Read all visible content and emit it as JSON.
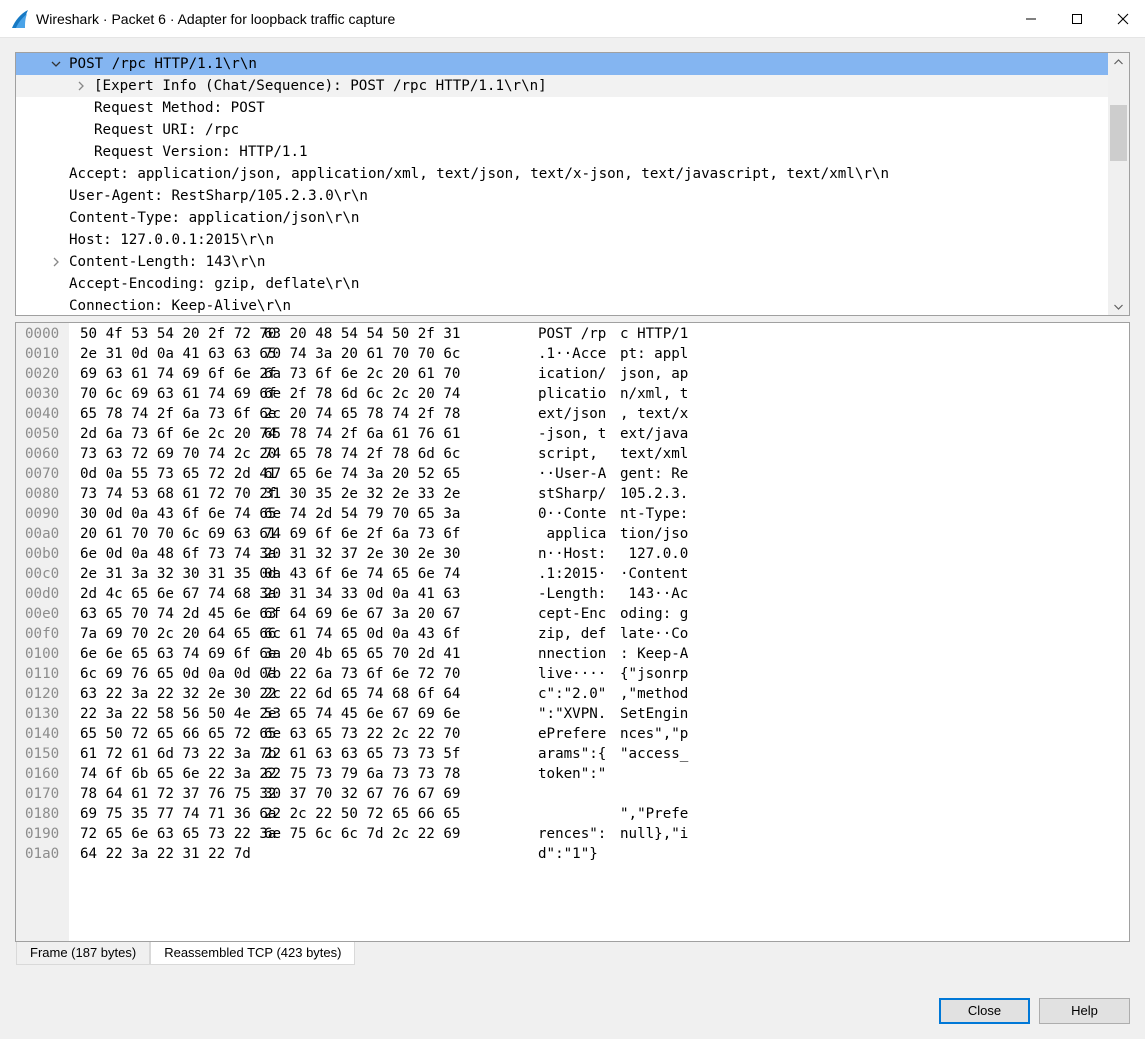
{
  "window": {
    "title": "Wireshark · Packet 6 · Adapter for loopback traffic capture"
  },
  "tree": {
    "lines": [
      {
        "text": "POST /rpc HTTP/1.1\\r\\n",
        "expander": "expanded",
        "level": 0,
        "state": "selected"
      },
      {
        "text": "[Expert Info (Chat/Sequence): POST /rpc HTTP/1.1\\r\\n]",
        "expander": "collapsed",
        "level": 1,
        "state": "hover"
      },
      {
        "text": "Request Method: POST",
        "expander": "none",
        "level": 1,
        "state": ""
      },
      {
        "text": "Request URI: /rpc",
        "expander": "none",
        "level": 1,
        "state": ""
      },
      {
        "text": "Request Version: HTTP/1.1",
        "expander": "none",
        "level": 1,
        "state": ""
      },
      {
        "text": "Accept: application/json, application/xml, text/json, text/x-json, text/javascript, text/xml\\r\\n",
        "expander": "none",
        "level": 0,
        "state": ""
      },
      {
        "text": "User-Agent: RestSharp/105.2.3.0\\r\\n",
        "expander": "none",
        "level": 0,
        "state": ""
      },
      {
        "text": "Content-Type: application/json\\r\\n",
        "expander": "none",
        "level": 0,
        "state": ""
      },
      {
        "text": "Host: 127.0.0.1:2015\\r\\n",
        "expander": "none",
        "level": 0,
        "state": ""
      },
      {
        "text": "Content-Length: 143\\r\\n",
        "expander": "collapsed",
        "level": 0,
        "state": ""
      },
      {
        "text": "Accept-Encoding: gzip, deflate\\r\\n",
        "expander": "none",
        "level": 0,
        "state": ""
      },
      {
        "text": "Connection: Keep-Alive\\r\\n",
        "expander": "none",
        "level": 0,
        "state": ""
      }
    ]
  },
  "hex": {
    "rows": [
      {
        "offset": "0000",
        "hex1": "50 4f 53 54 20 2f 72 70",
        "hex2": "63 20 48 54 54 50 2f 31",
        "ascii1": "POST /rp",
        "ascii2": "c HTTP/1"
      },
      {
        "offset": "0010",
        "hex1": "2e 31 0d 0a 41 63 63 65",
        "hex2": "70 74 3a 20 61 70 70 6c",
        "ascii1": ".1··Acce",
        "ascii2": "pt: appl"
      },
      {
        "offset": "0020",
        "hex1": "69 63 61 74 69 6f 6e 2f",
        "hex2": "6a 73 6f 6e 2c 20 61 70",
        "ascii1": "ication/",
        "ascii2": "json, ap"
      },
      {
        "offset": "0030",
        "hex1": "70 6c 69 63 61 74 69 6f",
        "hex2": "6e 2f 78 6d 6c 2c 20 74",
        "ascii1": "plicatio",
        "ascii2": "n/xml, t"
      },
      {
        "offset": "0040",
        "hex1": "65 78 74 2f 6a 73 6f 6e",
        "hex2": "2c 20 74 65 78 74 2f 78",
        "ascii1": "ext/json",
        "ascii2": ", text/x"
      },
      {
        "offset": "0050",
        "hex1": "2d 6a 73 6f 6e 2c 20 74",
        "hex2": "65 78 74 2f 6a 61 76 61",
        "ascii1": "-json, t",
        "ascii2": "ext/java"
      },
      {
        "offset": "0060",
        "hex1": "73 63 72 69 70 74 2c 20",
        "hex2": "74 65 78 74 2f 78 6d 6c",
        "ascii1": "script, ",
        "ascii2": "text/xml"
      },
      {
        "offset": "0070",
        "hex1": "0d 0a 55 73 65 72 2d 41",
        "hex2": "67 65 6e 74 3a 20 52 65",
        "ascii1": "··User-A",
        "ascii2": "gent: Re"
      },
      {
        "offset": "0080",
        "hex1": "73 74 53 68 61 72 70 2f",
        "hex2": "31 30 35 2e 32 2e 33 2e",
        "ascii1": "stSharp/",
        "ascii2": "105.2.3."
      },
      {
        "offset": "0090",
        "hex1": "30 0d 0a 43 6f 6e 74 65",
        "hex2": "6e 74 2d 54 79 70 65 3a",
        "ascii1": "0··Conte",
        "ascii2": "nt-Type:"
      },
      {
        "offset": "00a0",
        "hex1": "20 61 70 70 6c 69 63 61",
        "hex2": "74 69 6f 6e 2f 6a 73 6f",
        "ascii1": " applica",
        "ascii2": "tion/jso"
      },
      {
        "offset": "00b0",
        "hex1": "6e 0d 0a 48 6f 73 74 3a",
        "hex2": "20 31 32 37 2e 30 2e 30",
        "ascii1": "n··Host:",
        "ascii2": " 127.0.0"
      },
      {
        "offset": "00c0",
        "hex1": "2e 31 3a 32 30 31 35 0d",
        "hex2": "0a 43 6f 6e 74 65 6e 74",
        "ascii1": ".1:2015·",
        "ascii2": "·Content"
      },
      {
        "offset": "00d0",
        "hex1": "2d 4c 65 6e 67 74 68 3a",
        "hex2": "20 31 34 33 0d 0a 41 63",
        "ascii1": "-Length:",
        "ascii2": " 143··Ac"
      },
      {
        "offset": "00e0",
        "hex1": "63 65 70 74 2d 45 6e 63",
        "hex2": "6f 64 69 6e 67 3a 20 67",
        "ascii1": "cept-Enc",
        "ascii2": "oding: g"
      },
      {
        "offset": "00f0",
        "hex1": "7a 69 70 2c 20 64 65 66",
        "hex2": "6c 61 74 65 0d 0a 43 6f",
        "ascii1": "zip, def",
        "ascii2": "late··Co"
      },
      {
        "offset": "0100",
        "hex1": "6e 6e 65 63 74 69 6f 6e",
        "hex2": "3a 20 4b 65 65 70 2d 41",
        "ascii1": "nnection",
        "ascii2": ": Keep-A"
      },
      {
        "offset": "0110",
        "hex1": "6c 69 76 65 0d 0a 0d 0a",
        "hex2": "7b 22 6a 73 6f 6e 72 70",
        "ascii1": "live····",
        "ascii2": "{\"jsonrp"
      },
      {
        "offset": "0120",
        "hex1": "63 22 3a 22 32 2e 30 22",
        "hex2": "2c 22 6d 65 74 68 6f 64",
        "ascii1": "c\":\"2.0\"",
        "ascii2": ",\"method"
      },
      {
        "offset": "0130",
        "hex1": "22 3a 22 58 56 50 4e 2e",
        "hex2": "53 65 74 45 6e 67 69 6e",
        "ascii1": "\":\"XVPN.",
        "ascii2": "SetEngin"
      },
      {
        "offset": "0140",
        "hex1": "65 50 72 65 66 65 72 65",
        "hex2": "6e 63 65 73 22 2c 22 70",
        "ascii1": "ePrefere",
        "ascii2": "nces\",\"p"
      },
      {
        "offset": "0150",
        "hex1": "61 72 61 6d 73 22 3a 7b",
        "hex2": "22 61 63 63 65 73 73 5f",
        "ascii1": "arams\":{",
        "ascii2": "\"access_"
      },
      {
        "offset": "0160",
        "hex1": "74 6f 6b 65 6e 22 3a 22",
        "hex2": "62 75 73 79 6a 73 73 78",
        "ascii1": "token\":\"",
        "ascii2": ""
      },
      {
        "offset": "0170",
        "hex1": "78 64 61 72 37 76 75 32",
        "hex2": "30 37 70 32 67 76 67 69",
        "ascii1": "",
        "ascii2": ""
      },
      {
        "offset": "0180",
        "hex1": "69 75 35 77 74 71 36 6a",
        "hex2": "22 2c 22 50 72 65 66 65",
        "ascii1": "",
        "ascii2": "\",\"Prefe"
      },
      {
        "offset": "0190",
        "hex1": "72 65 6e 63 65 73 22 3a",
        "hex2": "6e 75 6c 6c 7d 2c 22 69",
        "ascii1": "rences\":",
        "ascii2": "null},\"i"
      },
      {
        "offset": "01a0",
        "hex1": "64 22 3a 22 31 22 7d",
        "hex2": "",
        "ascii1": "d\":\"1\"}",
        "ascii2": ""
      }
    ]
  },
  "tabs": [
    {
      "label": "Frame (187 bytes)",
      "active": false
    },
    {
      "label": "Reassembled TCP (423 bytes)",
      "active": true
    }
  ],
  "buttons": {
    "close": "Close",
    "help": "Help"
  },
  "colors": {
    "selection": "#84b5f1",
    "accent": "#0078d7",
    "offset_text": "#8c8c8c"
  }
}
